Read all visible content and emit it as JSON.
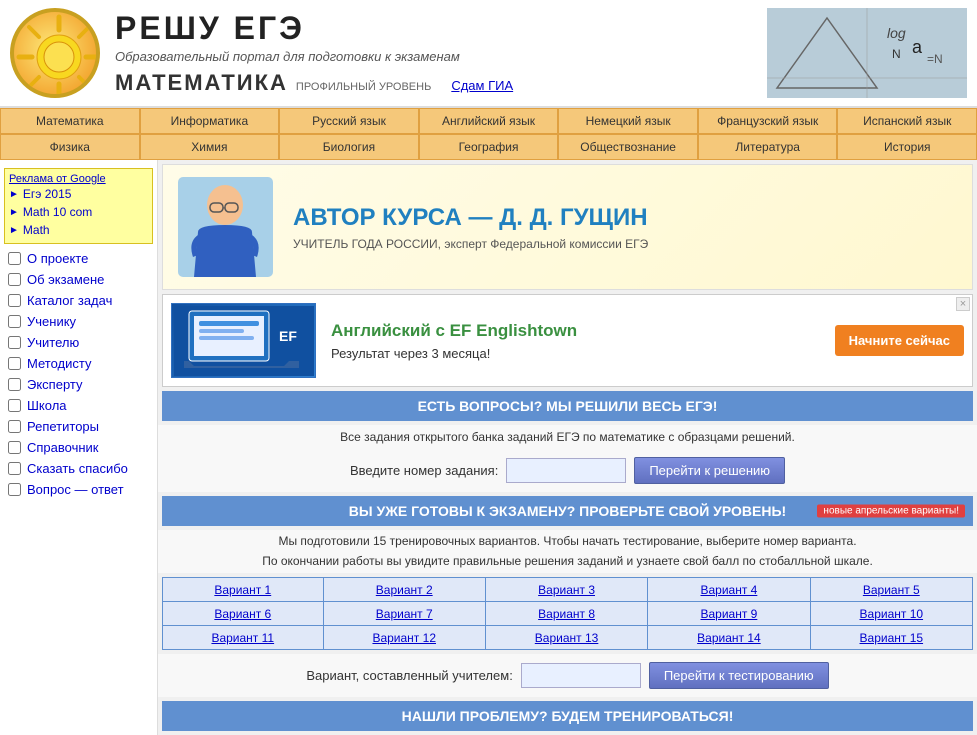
{
  "header": {
    "title": "РЕШУ ЕГЭ",
    "subtitle": "Образовательный портал для подготовки к экзаменам",
    "math_title": "МАТЕМАТИКА",
    "math_level": "ПРОФИЛЬНЫЙ УРОВЕНЬ",
    "gia_link": "Сдам ГИА"
  },
  "nav_row1": [
    "Математика",
    "Информатика",
    "Русский язык",
    "Английский язык",
    "Немецкий язык",
    "Французский язык",
    "Испанский язык"
  ],
  "nav_row2": [
    "Физика",
    "Химия",
    "Биология",
    "География",
    "Обществознание",
    "Литература",
    "История"
  ],
  "sidebar": {
    "ad_label": "Реклама от Google",
    "ad_items": [
      "Егэ 2015",
      "Math 10 com",
      "Math"
    ],
    "nav_items": [
      "О проекте",
      "Об экзамене",
      "Каталог задач",
      "Ученику",
      "Учителю",
      "Методисту",
      "Эксперту",
      "Школа",
      "Репетиторы",
      "Справочник",
      "Сказать спасибо",
      "Вопрос — ответ"
    ]
  },
  "hero": {
    "title": "АВТОР КУРСА — Д. Д. ГУЩИН",
    "subtitle": "УЧИТЕЛЬ ГОДА РОССИИ, эксперт Федеральной комиссии ЕГЭ"
  },
  "ad": {
    "title": "Английский с EF Englishtown",
    "subtitle": "Результат через 3 месяца!",
    "button": "Начните сейчас",
    "close": "×"
  },
  "section1": {
    "header": "ЕСТЬ ВОПРОСЫ? МЫ РЕШИЛИ ВЕСЬ ЕГЭ!",
    "subtext": "Все задания открытого банка заданий ЕГЭ по математике с образцами решений.",
    "label": "Введите номер задания:",
    "button": "Перейти к решению"
  },
  "section2": {
    "header": "ВЫ УЖЕ ГОТОВЫ К ЭКЗАМЕНУ? ПРОВЕРЬТЕ СВОЙ УРОВЕНЬ!",
    "badge": "новые апрельские варианты!",
    "subtext1": "Мы подготовили 15 тренировочных вариантов. Чтобы начать тестирование, выберите номер варианта.",
    "subtext2": "По окончании работы вы увидите правильные решения заданий и узнаете свой балл по стобалльной шкале.",
    "variants": [
      [
        "Вариант 1",
        "Вариант 2",
        "Вариант 3",
        "Вариант 4",
        "Вариант 5"
      ],
      [
        "Вариант 6",
        "Вариант 7",
        "Вариант 8",
        "Вариант 9",
        "Вариант 10"
      ],
      [
        "Вариант 11",
        "Вариант 12",
        "Вариант 13",
        "Вариант 14",
        "Вариант 15"
      ]
    ],
    "teacher_label": "Вариант, составленный учителем:",
    "teacher_button": "Перейти к тестированию"
  },
  "section3": {
    "header": "НАШЛИ ПРОБЛЕМУ? БУДЕМ ТРЕНИРОВАТЬСЯ!"
  }
}
